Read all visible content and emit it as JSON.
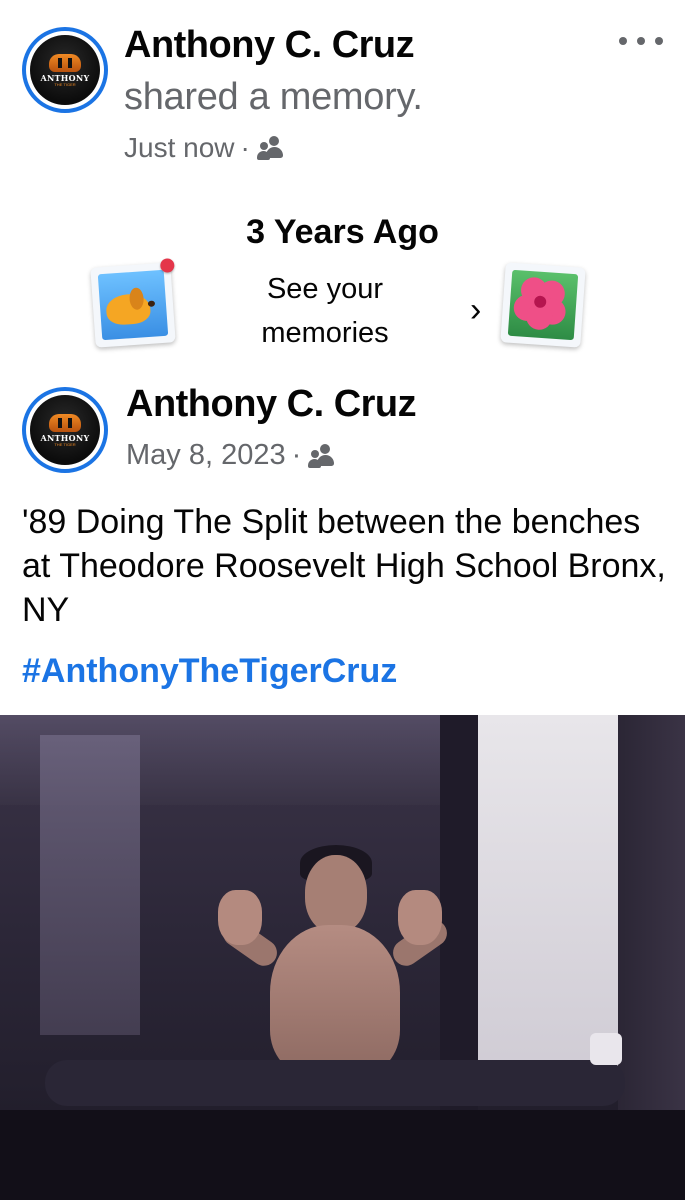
{
  "share": {
    "author": "Anthony C. Cruz",
    "action": "shared a memory.",
    "time": "Just now",
    "separator": "·",
    "audience_icon": "friends-icon",
    "more_icon": "more-options-icon"
  },
  "avatar": {
    "logo_text": "ANTHONY",
    "logo_sub": "THE TIGER"
  },
  "memory": {
    "title": "3 Years Ago",
    "subtitle": "See your memories",
    "chevron": "›",
    "left_sticker_icon": "dog-photo-icon",
    "right_sticker_icon": "hibiscus-photo-icon"
  },
  "post": {
    "author": "Anthony C. Cruz",
    "date": "May 8, 2023",
    "separator": "·",
    "audience_icon": "friends-icon",
    "text": "'89 Doing The Split between the benches at Theodore Roosevelt High School Bronx, NY",
    "hashtag": "#AnthonyTheTigerCruz"
  },
  "colors": {
    "link_blue": "#1b74e4",
    "secondary_text": "#65676b",
    "primary_text": "#050505"
  }
}
